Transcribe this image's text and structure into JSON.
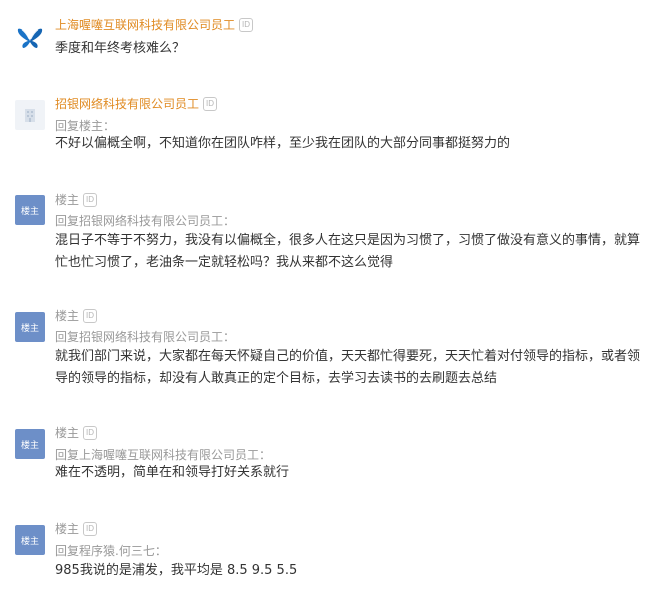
{
  "comments": [
    {
      "author": "上海喔噻互联网科技有限公司员工",
      "id_badge": "ID",
      "avatar_icon": "butterfly-logo-icon",
      "text": "季度和年终考核难么？"
    },
    {
      "author": "招银网络科技有限公司员工",
      "id_badge": "ID",
      "avatar_icon": "bank-building-icon",
      "reply_to": "回复楼主：",
      "text": "不好以偏概全啊，不知道你在团队咋样，至少我在团队的大部分同事都挺努力的"
    },
    {
      "author": "楼主",
      "id_badge": "ID",
      "avatar_label": "楼主",
      "reply_to": "回复招银网络科技有限公司员工：",
      "text": "混日子不等于不努力，我没有以偏概全，很多人在这只是因为习惯了，习惯了做没有意义的事情，就算忙也忙习惯了，老油条一定就轻松吗？我从来都不这么觉得"
    },
    {
      "author": "楼主",
      "id_badge": "ID",
      "avatar_label": "楼主",
      "reply_to": "回复招银网络科技有限公司员工：",
      "text": "就我们部门来说，大家都在每天怀疑自己的价值，天天都忙得要死，天天忙着对付领导的指标，或者领导的领导的指标，却没有人敢真正的定个目标，去学习去读书的去刷题去总结"
    },
    {
      "author": "楼主",
      "id_badge": "ID",
      "avatar_label": "楼主",
      "reply_to": "回复上海喔噻互联网科技有限公司员工：",
      "text": "难在不透明，简单在和领导打好关系就行"
    },
    {
      "author": "楼主",
      "id_badge": "ID",
      "avatar_label": "楼主",
      "reply_to": "回复程序猿.何三七：",
      "text": "985我说的是浦发，我平均是 8.5 9.5 5.5"
    }
  ],
  "colors": {
    "company_name": "#e08b23",
    "louzhu_name": "#999999",
    "louzhu_avatar_bg": "#6d8fc8",
    "body_text": "#333333",
    "reply_text": "#999999",
    "butterfly_blue": "#1a73c7"
  }
}
